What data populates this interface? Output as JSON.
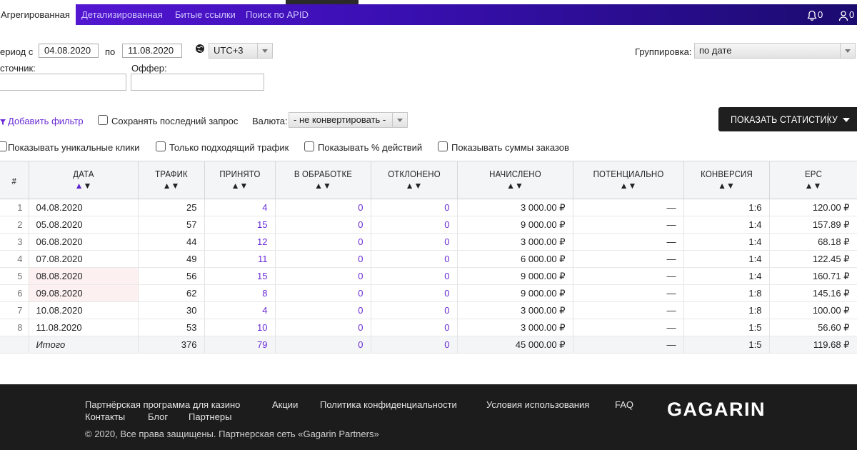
{
  "nav": {
    "tabs": [
      "Агрегированная",
      "Детализированная",
      "Битые ссылки",
      "Поиск по APID"
    ],
    "notifications_count": "0",
    "messages_count": "0"
  },
  "filters": {
    "period_label": "ериод с",
    "date_from": "04.08.2020",
    "to_label": "по",
    "date_to": "11.08.2020",
    "timezone": "UTC+3",
    "grouping_label": "Группировка:",
    "grouping_value": "по дате",
    "source_label": "сточник:",
    "offer_label": "Оффер:",
    "add_filter": "Добавить фильтр",
    "save_last_query": "Сохранять последний запрос",
    "currency_label": "Валюта:",
    "currency_value": "- не конвертировать -",
    "show_stats_button": "ПОКАЗАТЬ СТАТИСТИКУ",
    "options": [
      "Показывать уникальные клики",
      "Только подходящий трафик",
      "Показывать % действий",
      "Показывать суммы заказов"
    ]
  },
  "table": {
    "headers": [
      "#",
      "ДАТА",
      "ТРАФИК",
      "ПРИНЯТО",
      "В ОБРАБОТКЕ",
      "ОТКЛОНЕНО",
      "НАЧИСЛЕНО",
      "ПОТЕНЦИАЛЬНО",
      "КОНВЕРСИЯ",
      "EPC"
    ],
    "rows": [
      {
        "n": "1",
        "date": "04.08.2020",
        "traffic": "25",
        "accepted": "4",
        "processing": "0",
        "rejected": "0",
        "credited": "3 000.00 ₽",
        "potential": "—",
        "conversion": "1:6",
        "epc": "120.00 ₽"
      },
      {
        "n": "2",
        "date": "05.08.2020",
        "traffic": "57",
        "accepted": "15",
        "processing": "0",
        "rejected": "0",
        "credited": "9 000.00 ₽",
        "potential": "—",
        "conversion": "1:4",
        "epc": "157.89 ₽"
      },
      {
        "n": "3",
        "date": "06.08.2020",
        "traffic": "44",
        "accepted": "12",
        "processing": "0",
        "rejected": "0",
        "credited": "3 000.00 ₽",
        "potential": "—",
        "conversion": "1:4",
        "epc": "68.18 ₽"
      },
      {
        "n": "4",
        "date": "07.08.2020",
        "traffic": "49",
        "accepted": "11",
        "processing": "0",
        "rejected": "0",
        "credited": "6 000.00 ₽",
        "potential": "—",
        "conversion": "1:4",
        "epc": "122.45 ₽"
      },
      {
        "n": "5",
        "date": "08.08.2020",
        "traffic": "56",
        "accepted": "15",
        "processing": "0",
        "rejected": "0",
        "credited": "9 000.00 ₽",
        "potential": "—",
        "conversion": "1:4",
        "epc": "160.71 ₽"
      },
      {
        "n": "6",
        "date": "09.08.2020",
        "traffic": "62",
        "accepted": "8",
        "processing": "0",
        "rejected": "0",
        "credited": "9 000.00 ₽",
        "potential": "—",
        "conversion": "1:8",
        "epc": "145.16 ₽"
      },
      {
        "n": "7",
        "date": "10.08.2020",
        "traffic": "30",
        "accepted": "4",
        "processing": "0",
        "rejected": "0",
        "credited": "3 000.00 ₽",
        "potential": "—",
        "conversion": "1:8",
        "epc": "100.00 ₽"
      },
      {
        "n": "8",
        "date": "11.08.2020",
        "traffic": "53",
        "accepted": "10",
        "processing": "0",
        "rejected": "0",
        "credited": "3 000.00 ₽",
        "potential": "—",
        "conversion": "1:5",
        "epc": "56.60 ₽"
      }
    ],
    "total": {
      "label": "Итого",
      "traffic": "376",
      "accepted": "79",
      "processing": "0",
      "rejected": "0",
      "credited": "45 000.00 ₽",
      "potential": "—",
      "conversion": "1:5",
      "epc": "119.68 ₽"
    }
  },
  "footer": {
    "links_row1": [
      "Партнёрская программа для казино",
      "Акции",
      "Политика конфиденциальности",
      "Условия использования",
      "FAQ"
    ],
    "links_row2": [
      "Контакты",
      "Блог",
      "Партнеры"
    ],
    "copyright": "© 2020, Все права защищены. Партнерская сеть «Gagarin Partners»",
    "logo": "GAGARIN"
  },
  "colors": {
    "accent": "#6a2bd6",
    "nav_start": "#5a18d8",
    "nav_end": "#1b0b6f",
    "button": "#1f1f1f",
    "footer": "#1c1c1c"
  }
}
